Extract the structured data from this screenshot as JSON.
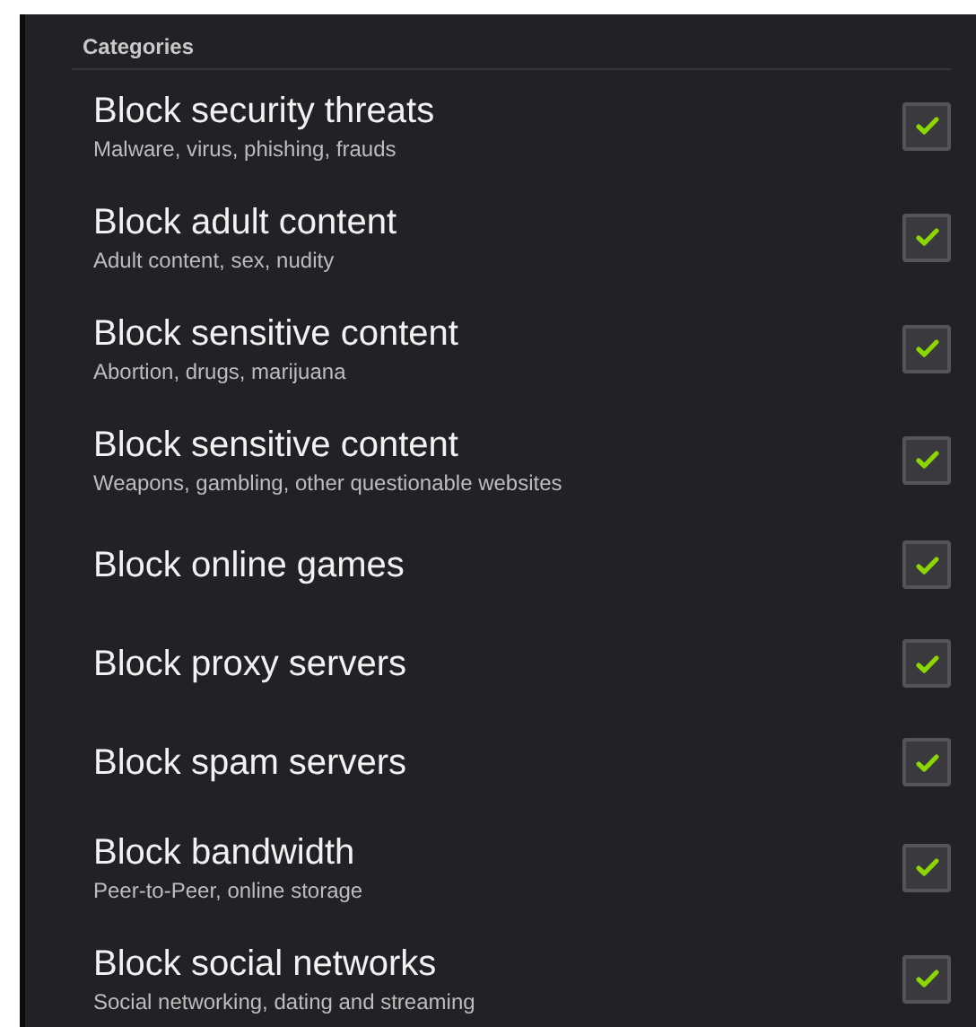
{
  "header": "Categories",
  "items": [
    {
      "title": "Block security threats",
      "subtitle": "Malware, virus, phishing, frauds",
      "checked": true
    },
    {
      "title": "Block adult content",
      "subtitle": "Adult content, sex, nudity",
      "checked": true
    },
    {
      "title": "Block sensitive content",
      "subtitle": "Abortion, drugs, marijuana",
      "checked": true
    },
    {
      "title": "Block sensitive content",
      "subtitle": "Weapons, gambling, other questionable websites",
      "checked": true
    },
    {
      "title": "Block online games",
      "checked": true
    },
    {
      "title": "Block proxy servers",
      "checked": true
    },
    {
      "title": "Block spam servers",
      "checked": true
    },
    {
      "title": "Block bandwidth",
      "subtitle": "Peer-to-Peer, online storage",
      "checked": true
    },
    {
      "title": "Block social networks",
      "subtitle": "Social networking, dating and streaming",
      "checked": true
    }
  ]
}
